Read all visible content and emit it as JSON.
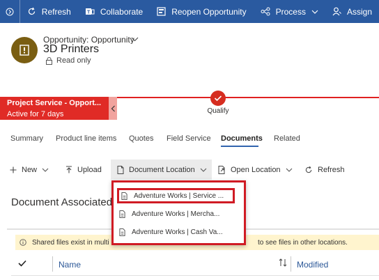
{
  "command_bar": {
    "refresh": "Refresh",
    "collaborate": "Collaborate",
    "reopen": "Reopen Opportunity",
    "process": "Process",
    "assign": "Assign"
  },
  "header": {
    "entity_type": "Opportunity: Opportunity",
    "title": "3D Printers",
    "status": "Read only"
  },
  "process_flow": {
    "stage_name": "Project Service - Opport...",
    "stage_status": "Active for 7 days",
    "current_stage": "Qualify"
  },
  "tabs": [
    "Summary",
    "Product line items",
    "Quotes",
    "Field Service",
    "Documents",
    "Related"
  ],
  "sub_toolbar": {
    "new": "New",
    "upload": "Upload",
    "document_location": "Document Location",
    "open_location": "Open Location",
    "refresh": "Refresh"
  },
  "section_title": "Document Associated",
  "info_bar": {
    "text_left": "Shared files exist in multi",
    "text_right": "to see files in other locations."
  },
  "grid": {
    "col_name": "Name",
    "col_modified": "Modified"
  },
  "dropdown": {
    "items": [
      "Adventure Works | Service ...",
      "Adventure Works | Mercha...",
      "Adventure Works | Cash Va..."
    ]
  },
  "colors": {
    "command_bar": "#2a5aa0",
    "stage": "#e02b26",
    "accent_red": "#d01b24",
    "info_bar": "#fff4ce"
  }
}
